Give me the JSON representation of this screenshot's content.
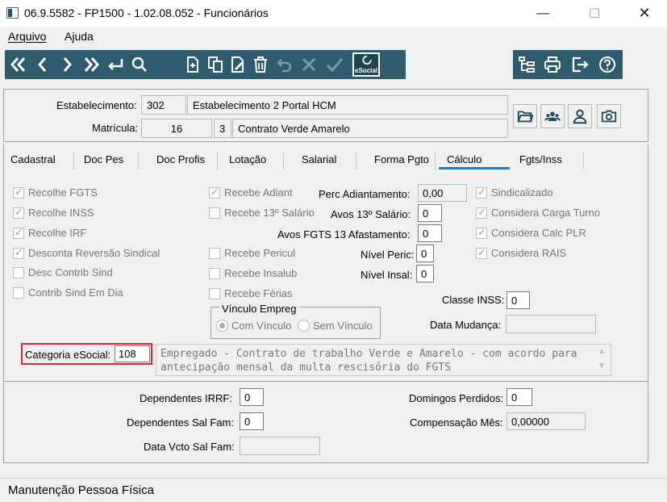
{
  "window": {
    "title": "06.9.5582 - FP1500 - 1.02.08.052 - Funcionários",
    "minimize": "—",
    "maximize": "☐",
    "close": "✕"
  },
  "menu": {
    "arquivo": "Arquivo",
    "ajuda": "Ajuda"
  },
  "toolbar": {
    "esocial_label": "eSocial",
    "left_icons": [
      "first-record-icon",
      "previous-record-icon",
      "next-record-icon",
      "last-record-icon",
      "return-icon",
      "search-icon",
      "new-record-icon",
      "copy-record-icon",
      "edit-record-icon",
      "delete-icon",
      "undo-icon",
      "cancel-icon",
      "confirm-icon",
      "esocial-icon"
    ],
    "right_icons": [
      "tree-structure-icon",
      "printer-icon",
      "exit-icon",
      "help-icon"
    ],
    "color": "#2e5c6e"
  },
  "header": {
    "estabelecimento_label": "Estabelecimento:",
    "estabelecimento_code": "302",
    "estabelecimento_name": "Estabelecimento 2 Portal HCM",
    "matricula_label": "Matrícula:",
    "matricula_value": "16",
    "contrato_code": "3",
    "contrato_name": "Contrato Verde Amarelo"
  },
  "tabs": [
    {
      "label": "Cadastral"
    },
    {
      "label": "Doc Pes"
    },
    {
      "label": "Doc Profis"
    },
    {
      "label": "Lotação"
    },
    {
      "label": "Salarial"
    },
    {
      "label": "Forma Pgto"
    },
    {
      "label": "Cálculo"
    },
    {
      "label": "Fgts/Inss"
    }
  ],
  "active_tab": "Cálculo",
  "calculo": {
    "col1": [
      {
        "label": "Recolhe FGTS",
        "checked": true
      },
      {
        "label": "Recolhe INSS",
        "checked": true
      },
      {
        "label": "Recolhe IRF",
        "checked": true
      },
      {
        "label": "Desconta Reversão Sindical",
        "checked": true
      },
      {
        "label": "Desc Contrib Sind",
        "checked": false
      },
      {
        "label": "Contrib Sind Em Dia",
        "checked": false
      }
    ],
    "col2": [
      {
        "label": "Recebe Adiant",
        "checked": true
      },
      {
        "label": "Recebe 13º Salário",
        "checked": false
      },
      {
        "label": "Recebe Pericul",
        "checked": false
      },
      {
        "label": "Recebe Insalub",
        "checked": false
      },
      {
        "label": "Recebe Férias",
        "checked": false
      }
    ],
    "col4": [
      {
        "label": "Sindicalizado",
        "checked": true
      },
      {
        "label": "Considera Carga Turno",
        "checked": true
      },
      {
        "label": "Considera Calc PLR",
        "checked": true
      },
      {
        "label": "Considera RAIS",
        "checked": true
      }
    ],
    "perc_adiant_label": "Perc Adiantamento:",
    "perc_adiant_value": "0,00",
    "avos13_label": "Avos 13º Salário:",
    "avos13_value": "0",
    "avos_fgts_label": "Avos FGTS 13 Afastamento:",
    "avos_fgts_value": "0",
    "nivel_peric_label": "Nível Peric:",
    "nivel_peric_value": "0",
    "nivel_insal_label": "Nível Insal:",
    "nivel_insal_value": "0",
    "classe_inss_label": "Classe INSS:",
    "classe_inss_value": "0",
    "data_mudanca_label": "Data Mudança:",
    "data_mudanca_value": "",
    "vinculo_title": "Vínculo Empreg",
    "vinculo_options": [
      "Com Vínculo",
      "Sem Vínculo"
    ],
    "vinculo_selected": "Com Vínculo",
    "categoria_label": "Categoria eSocial:",
    "categoria_value": "108",
    "categoria_desc_line1": "Empregado - Contrato de trabalho Verde e Amarelo - com acordo para",
    "categoria_desc_line2": "antecipação mensal da multa rescisória do FGTS",
    "dependentes_irrf_label": "Dependentes IRRF:",
    "dependentes_irrf_value": "0",
    "dependentes_salfam_label": "Dependentes Sal Fam:",
    "dependentes_salfam_value": "0",
    "data_vcto_label": "Data Vcto Sal Fam:",
    "data_vcto_value": "",
    "domingos_label": "Domingos Perdidos:",
    "domingos_value": "0",
    "compensacao_label": "Compensação Mês:",
    "compensacao_value": "0,00000"
  },
  "status": {
    "text": "Manutenção Pessoa Física"
  }
}
